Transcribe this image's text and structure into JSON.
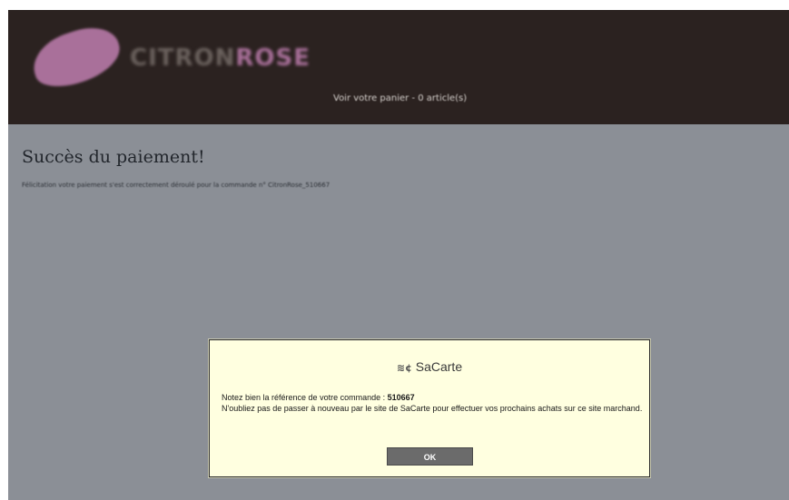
{
  "header": {
    "logo": {
      "text_part1": "CITRON",
      "text_part2": "ROSE",
      "blob_color": "#a9709a"
    },
    "cart_link": "Voir votre panier - 0 article(s)",
    "background": "#2b2220"
  },
  "main": {
    "title": "Succès du paiement!",
    "message": "Félicitation votre paiement s'est correctement déroulé pour la commande n° CitronRose_510667",
    "background": "#8b8f96"
  },
  "dialog": {
    "brand_icon": "≋¢",
    "brand_name": "SaCarte",
    "line1_prefix": "Notez bien la référence de votre commande : ",
    "reference": "510667",
    "line2": "N'oubliez pas de passer à nouveau par le site de SaCarte pour effectuer vos prochains achats sur ce site marchand.",
    "ok_label": "OK",
    "background": "#ffffe0"
  }
}
